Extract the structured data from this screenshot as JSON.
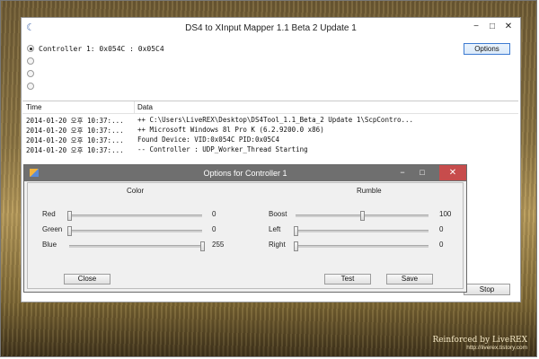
{
  "window": {
    "title": "DS4 to XInput Mapper 1.1 Beta 2 Update 1",
    "minimize": "−",
    "maximize": "□",
    "close": "✕"
  },
  "controllers": [
    {
      "label": "Controller 1: 0x054C : 0x05C4",
      "selected": true
    },
    {
      "label": "",
      "selected": false
    },
    {
      "label": "",
      "selected": false
    },
    {
      "label": "",
      "selected": false
    }
  ],
  "buttons": {
    "options": "Options",
    "stop": "Stop"
  },
  "log": {
    "columns": [
      "Time",
      "Data"
    ],
    "rows": [
      {
        "time": "2014-01-20 오후 10:37:...",
        "data": "++ C:\\Users\\LiveREX\\Desktop\\DS4Tool_1.1_Beta_2 Update 1\\ScpContro..."
      },
      {
        "time": "2014-01-20 오후 10:37:...",
        "data": "++ Microsoft Windows 8l Pro K (6.2.9200.0 x86)"
      },
      {
        "time": "2014-01-20 오후 10:37:...",
        "data": "Found Device: VID:0x054C PID:0x05C4"
      },
      {
        "time": "2014-01-20 오후 10:37:...",
        "data": "-- Controller : UDP_Worker_Thread Starting"
      }
    ]
  },
  "dialog": {
    "title": "Options for Controller 1",
    "minimize": "−",
    "maximize": "□",
    "close": "✕",
    "color_section": "Color",
    "rumble_section": "Rumble",
    "sliders": {
      "red": {
        "label": "Red",
        "value": "0",
        "level": 0.0
      },
      "green": {
        "label": "Green",
        "value": "0",
        "level": 0.0
      },
      "blue": {
        "label": "Blue",
        "value": "255",
        "level": 1.0
      },
      "boost": {
        "label": "Boost",
        "value": "100",
        "level": 0.5
      },
      "left": {
        "label": "Left",
        "value": "0",
        "level": 0.0
      },
      "right": {
        "label": "Right",
        "value": "0",
        "level": 0.0
      }
    },
    "buttons": {
      "close": "Close",
      "test": "Test",
      "save": "Save"
    }
  },
  "watermark": {
    "text": "Reinforced by LiveREX",
    "url": "http://liverex.tistory.com"
  }
}
